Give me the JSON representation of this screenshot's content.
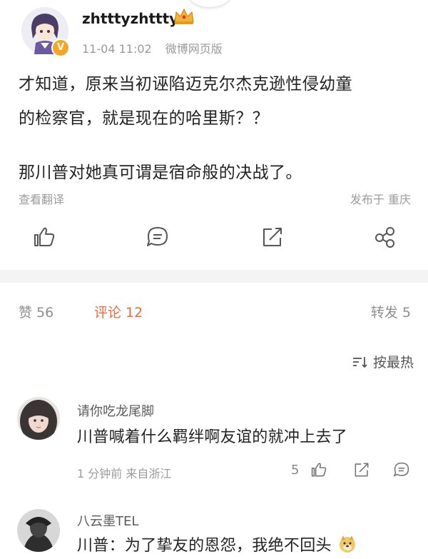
{
  "post": {
    "username": "zhtttyzhttty",
    "time": "11-04 11:02",
    "source": "微博网页版",
    "lines": [
      "才知道，原来当初诬陷迈克尔杰克逊性侵幼童",
      "的检察官，就是现在的哈里斯？？",
      "那川普对她真可谓是宿命般的决战了。"
    ],
    "translate": "查看翻译",
    "location": "发布于 重庆",
    "icons": {
      "like": "thumbs-up-icon",
      "comment": "comment-icon",
      "repost": "share-out-icon",
      "share": "share-nodes-icon"
    },
    "verified_badge": "V"
  },
  "tabs": {
    "likes": "赞 56",
    "comments": "评论 12",
    "reposts": "转发 5"
  },
  "sort": {
    "icon": "sort-icon",
    "label": "按最热"
  },
  "comments": [
    {
      "name": "请你吃龙尾脚",
      "text": "川普喊着什么羁绊啊友谊的就冲上去了",
      "meta": "1 分钟前  来自浙江",
      "like_count": "5"
    },
    {
      "name": "八云墨TEL",
      "text": "川普：为了挚友的恩怨，我绝不回头",
      "emoji": "doge-emoji"
    }
  ],
  "colors": {
    "accent": "#e86a3d",
    "grey_text": "#9c9c9c",
    "badge": "#f5a623"
  }
}
